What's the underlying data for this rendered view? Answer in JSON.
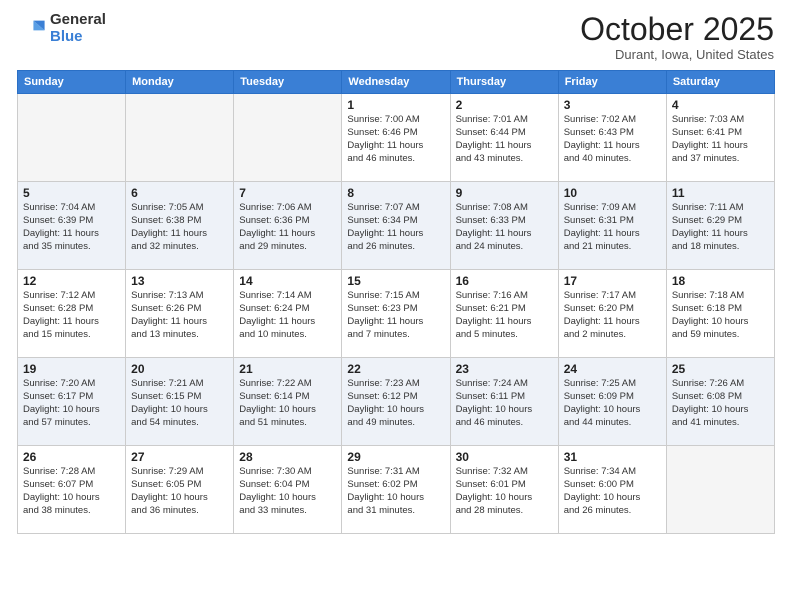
{
  "header": {
    "logo_general": "General",
    "logo_blue": "Blue",
    "month_title": "October 2025",
    "location": "Durant, Iowa, United States"
  },
  "days_of_week": [
    "Sunday",
    "Monday",
    "Tuesday",
    "Wednesday",
    "Thursday",
    "Friday",
    "Saturday"
  ],
  "weeks": [
    [
      {
        "num": "",
        "info": ""
      },
      {
        "num": "",
        "info": ""
      },
      {
        "num": "",
        "info": ""
      },
      {
        "num": "1",
        "info": "Sunrise: 7:00 AM\nSunset: 6:46 PM\nDaylight: 11 hours\nand 46 minutes."
      },
      {
        "num": "2",
        "info": "Sunrise: 7:01 AM\nSunset: 6:44 PM\nDaylight: 11 hours\nand 43 minutes."
      },
      {
        "num": "3",
        "info": "Sunrise: 7:02 AM\nSunset: 6:43 PM\nDaylight: 11 hours\nand 40 minutes."
      },
      {
        "num": "4",
        "info": "Sunrise: 7:03 AM\nSunset: 6:41 PM\nDaylight: 11 hours\nand 37 minutes."
      }
    ],
    [
      {
        "num": "5",
        "info": "Sunrise: 7:04 AM\nSunset: 6:39 PM\nDaylight: 11 hours\nand 35 minutes."
      },
      {
        "num": "6",
        "info": "Sunrise: 7:05 AM\nSunset: 6:38 PM\nDaylight: 11 hours\nand 32 minutes."
      },
      {
        "num": "7",
        "info": "Sunrise: 7:06 AM\nSunset: 6:36 PM\nDaylight: 11 hours\nand 29 minutes."
      },
      {
        "num": "8",
        "info": "Sunrise: 7:07 AM\nSunset: 6:34 PM\nDaylight: 11 hours\nand 26 minutes."
      },
      {
        "num": "9",
        "info": "Sunrise: 7:08 AM\nSunset: 6:33 PM\nDaylight: 11 hours\nand 24 minutes."
      },
      {
        "num": "10",
        "info": "Sunrise: 7:09 AM\nSunset: 6:31 PM\nDaylight: 11 hours\nand 21 minutes."
      },
      {
        "num": "11",
        "info": "Sunrise: 7:11 AM\nSunset: 6:29 PM\nDaylight: 11 hours\nand 18 minutes."
      }
    ],
    [
      {
        "num": "12",
        "info": "Sunrise: 7:12 AM\nSunset: 6:28 PM\nDaylight: 11 hours\nand 15 minutes."
      },
      {
        "num": "13",
        "info": "Sunrise: 7:13 AM\nSunset: 6:26 PM\nDaylight: 11 hours\nand 13 minutes."
      },
      {
        "num": "14",
        "info": "Sunrise: 7:14 AM\nSunset: 6:24 PM\nDaylight: 11 hours\nand 10 minutes."
      },
      {
        "num": "15",
        "info": "Sunrise: 7:15 AM\nSunset: 6:23 PM\nDaylight: 11 hours\nand 7 minutes."
      },
      {
        "num": "16",
        "info": "Sunrise: 7:16 AM\nSunset: 6:21 PM\nDaylight: 11 hours\nand 5 minutes."
      },
      {
        "num": "17",
        "info": "Sunrise: 7:17 AM\nSunset: 6:20 PM\nDaylight: 11 hours\nand 2 minutes."
      },
      {
        "num": "18",
        "info": "Sunrise: 7:18 AM\nSunset: 6:18 PM\nDaylight: 10 hours\nand 59 minutes."
      }
    ],
    [
      {
        "num": "19",
        "info": "Sunrise: 7:20 AM\nSunset: 6:17 PM\nDaylight: 10 hours\nand 57 minutes."
      },
      {
        "num": "20",
        "info": "Sunrise: 7:21 AM\nSunset: 6:15 PM\nDaylight: 10 hours\nand 54 minutes."
      },
      {
        "num": "21",
        "info": "Sunrise: 7:22 AM\nSunset: 6:14 PM\nDaylight: 10 hours\nand 51 minutes."
      },
      {
        "num": "22",
        "info": "Sunrise: 7:23 AM\nSunset: 6:12 PM\nDaylight: 10 hours\nand 49 minutes."
      },
      {
        "num": "23",
        "info": "Sunrise: 7:24 AM\nSunset: 6:11 PM\nDaylight: 10 hours\nand 46 minutes."
      },
      {
        "num": "24",
        "info": "Sunrise: 7:25 AM\nSunset: 6:09 PM\nDaylight: 10 hours\nand 44 minutes."
      },
      {
        "num": "25",
        "info": "Sunrise: 7:26 AM\nSunset: 6:08 PM\nDaylight: 10 hours\nand 41 minutes."
      }
    ],
    [
      {
        "num": "26",
        "info": "Sunrise: 7:28 AM\nSunset: 6:07 PM\nDaylight: 10 hours\nand 38 minutes."
      },
      {
        "num": "27",
        "info": "Sunrise: 7:29 AM\nSunset: 6:05 PM\nDaylight: 10 hours\nand 36 minutes."
      },
      {
        "num": "28",
        "info": "Sunrise: 7:30 AM\nSunset: 6:04 PM\nDaylight: 10 hours\nand 33 minutes."
      },
      {
        "num": "29",
        "info": "Sunrise: 7:31 AM\nSunset: 6:02 PM\nDaylight: 10 hours\nand 31 minutes."
      },
      {
        "num": "30",
        "info": "Sunrise: 7:32 AM\nSunset: 6:01 PM\nDaylight: 10 hours\nand 28 minutes."
      },
      {
        "num": "31",
        "info": "Sunrise: 7:34 AM\nSunset: 6:00 PM\nDaylight: 10 hours\nand 26 minutes."
      },
      {
        "num": "",
        "info": ""
      }
    ]
  ]
}
